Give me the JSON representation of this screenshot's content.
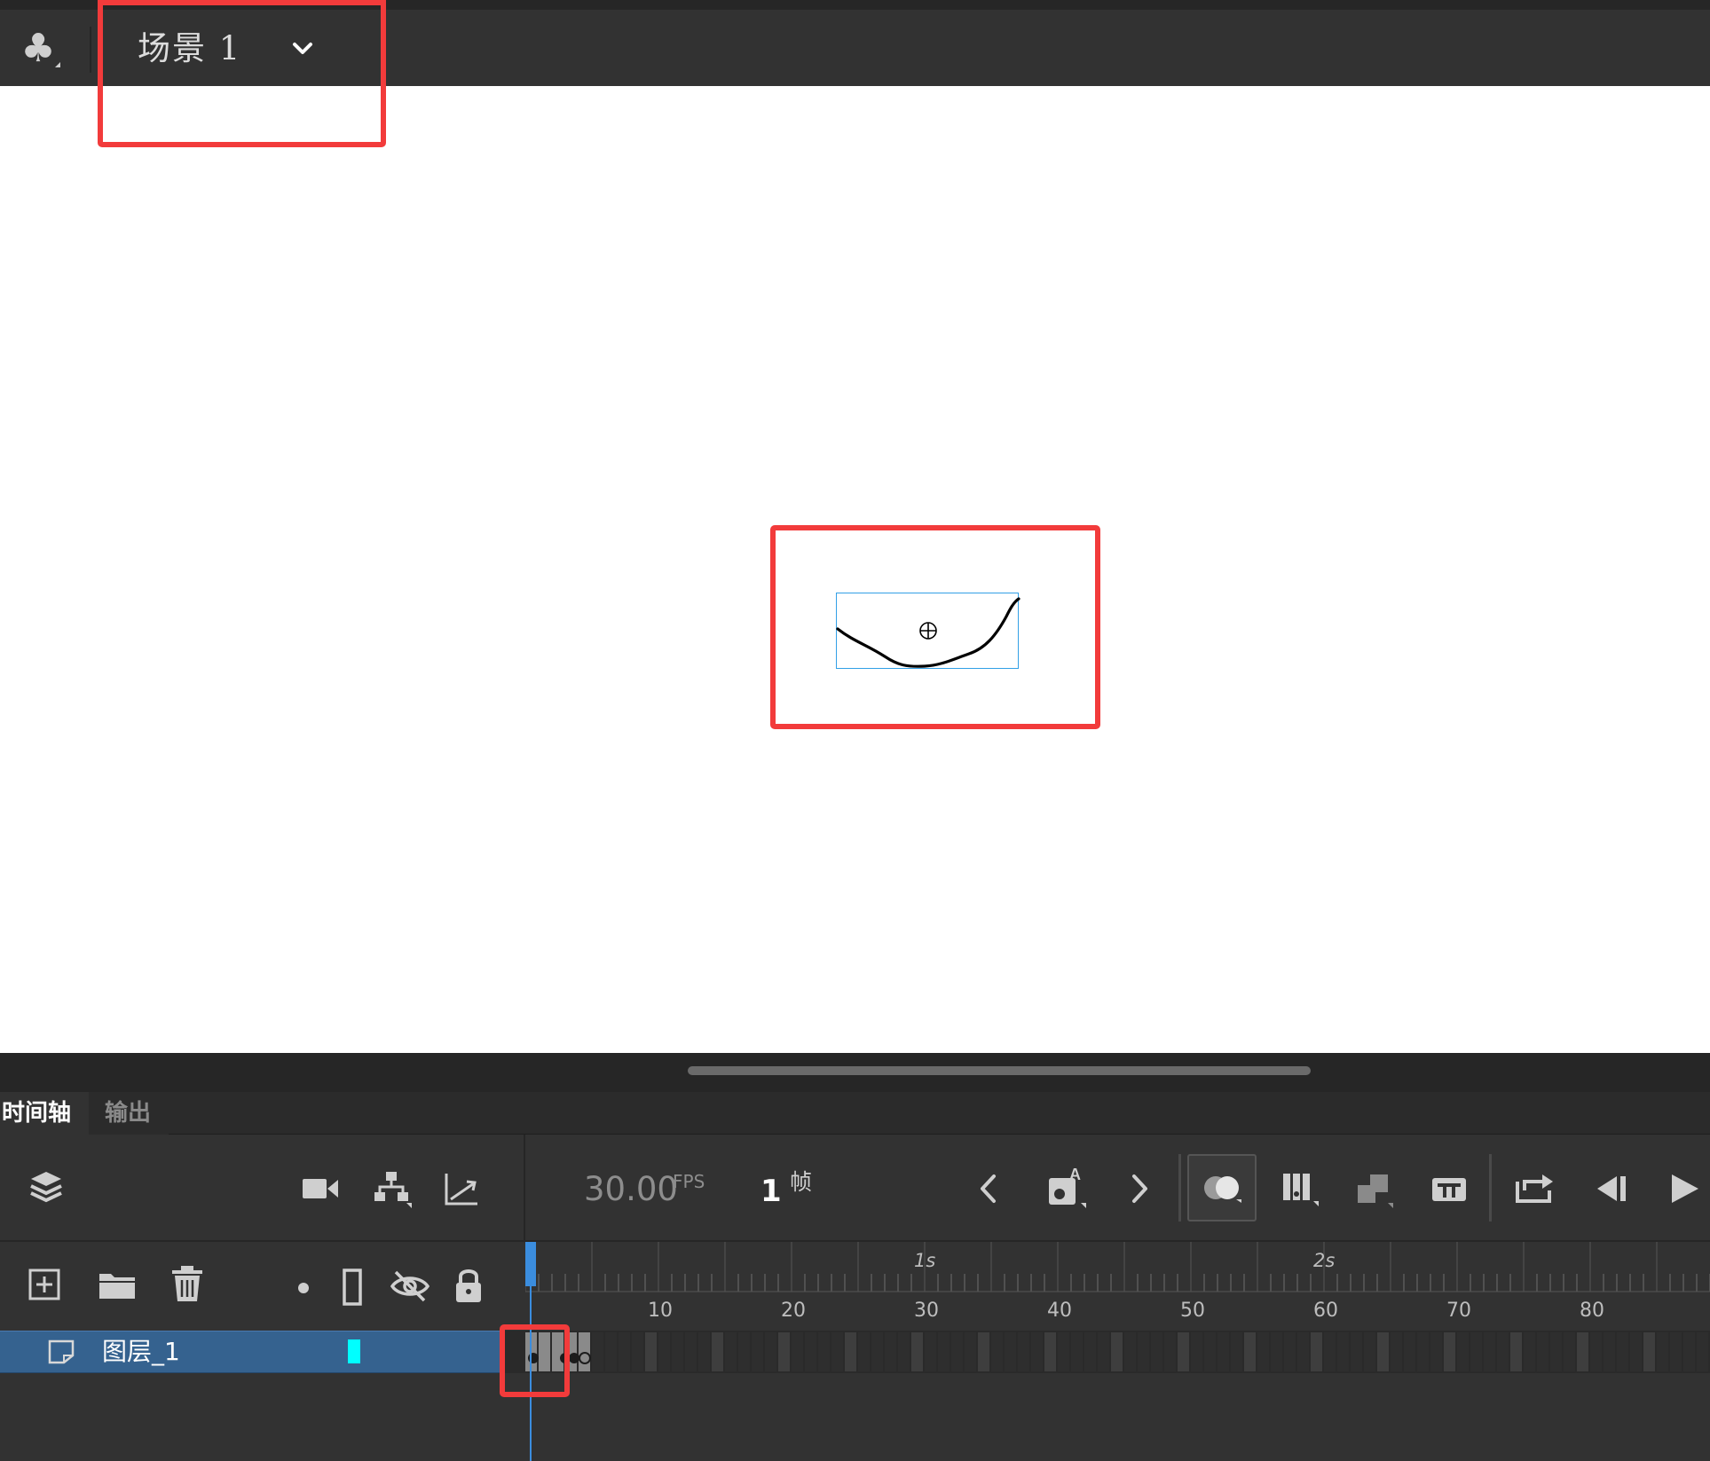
{
  "scene_bar": {
    "scene_icon": "club-icon",
    "scene_name": "场景 1",
    "dropdown_icon": "chevron-down-icon"
  },
  "panel_tabs": {
    "timeline": "时间轴",
    "output": "输出"
  },
  "timeline": {
    "fps_value": "30.00",
    "fps_unit": "FPS",
    "current_frame": "1",
    "frame_unit": "帧",
    "ruler": {
      "frame_labels": [
        "10",
        "20",
        "30",
        "40",
        "50",
        "60",
        "70",
        "80"
      ],
      "second_labels": [
        "1s",
        "2s"
      ]
    },
    "layers": [
      {
        "name": "图层_1",
        "color": "#00ffff",
        "selected": true
      }
    ]
  },
  "colors": {
    "panel_bg": "#323232",
    "stage_bg": "#ffffff",
    "layer_selected": "#35628f",
    "playhead": "#3b8dde",
    "highlight": "#f23b3b",
    "selection_box": "#32a0e6"
  }
}
